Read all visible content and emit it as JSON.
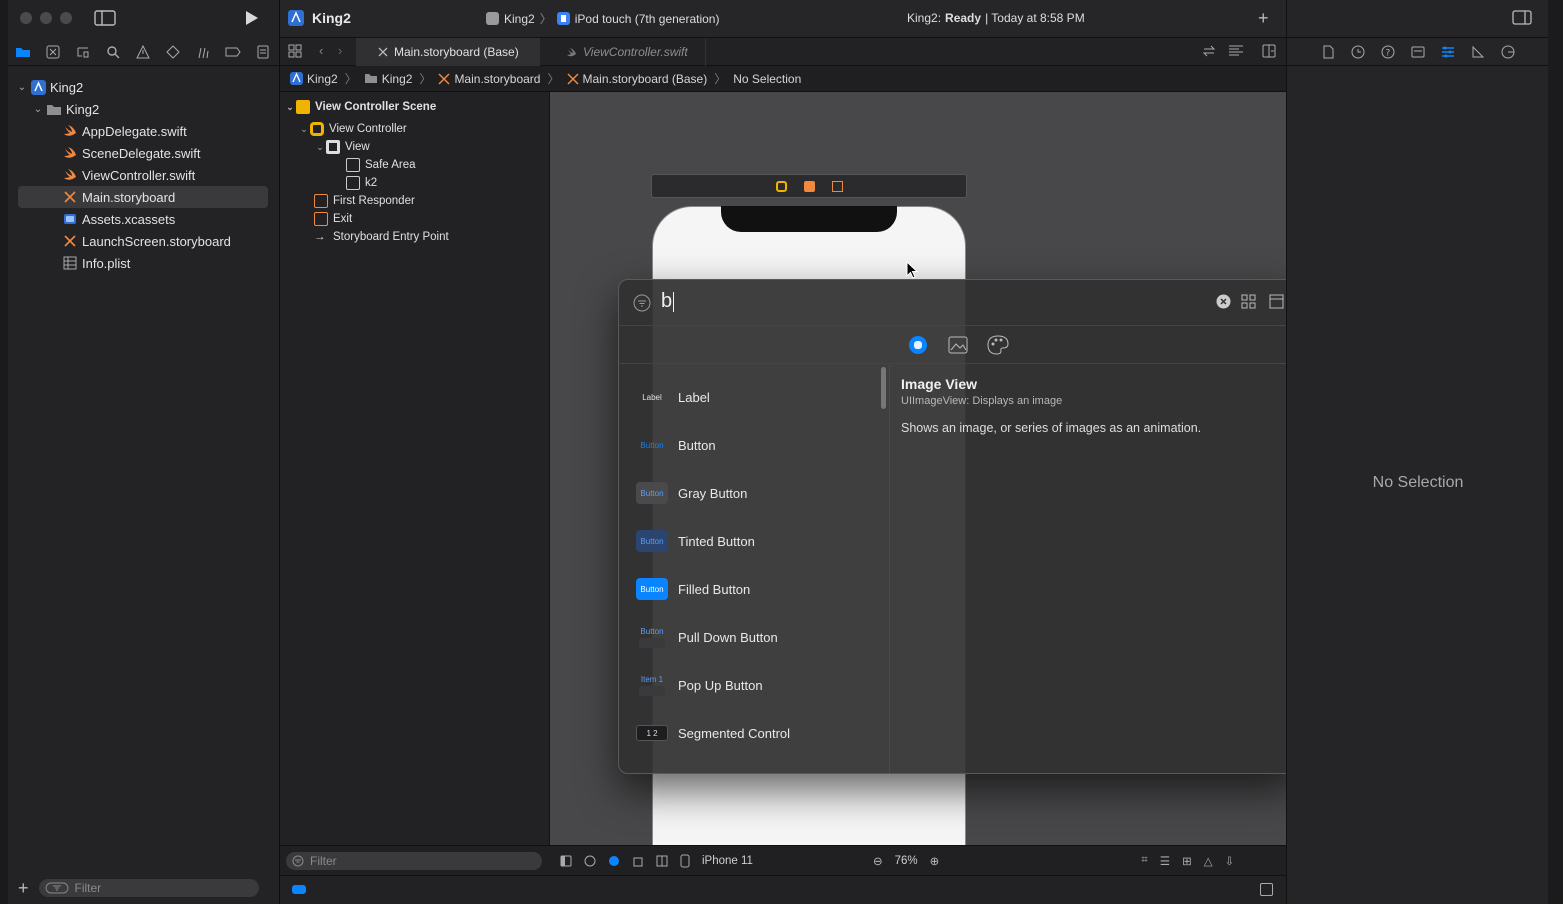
{
  "navigator": {
    "project_name": "King2",
    "items": [
      {
        "label": "King2",
        "icon": "project-icon",
        "level": 0,
        "expanded": true
      },
      {
        "label": "King2",
        "icon": "folder-icon",
        "level": 1,
        "expanded": true
      },
      {
        "label": "AppDelegate.swift",
        "icon": "swift-file-icon",
        "level": 2
      },
      {
        "label": "SceneDelegate.swift",
        "icon": "swift-file-icon",
        "level": 2
      },
      {
        "label": "ViewController.swift",
        "icon": "swift-file-icon",
        "level": 2
      },
      {
        "label": "Main.storyboard",
        "icon": "storyboard-icon",
        "level": 2,
        "selected": true
      },
      {
        "label": "Assets.xcassets",
        "icon": "assets-icon",
        "level": 2
      },
      {
        "label": "LaunchScreen.storyboard",
        "icon": "storyboard-icon",
        "level": 2
      },
      {
        "label": "Info.plist",
        "icon": "plist-icon",
        "level": 2
      }
    ],
    "filter_placeholder": "Filter"
  },
  "toolbar": {
    "project_title": "King2",
    "scheme": "King2",
    "destination": "iPod touch (7th generation)",
    "status_project": "King2:",
    "status_state": "Ready",
    "status_time": "| Today at 8:58 PM"
  },
  "tabs": [
    {
      "label": "Main.storyboard (Base)",
      "active": true
    },
    {
      "label": "ViewController.swift",
      "active": false
    }
  ],
  "jumpbar": [
    "King2",
    "King2",
    "Main.storyboard",
    "Main.storyboard (Base)",
    "No Selection"
  ],
  "outline": {
    "items": [
      {
        "label": "View Controller Scene",
        "bold": true
      },
      {
        "label": "View Controller"
      },
      {
        "label": "View"
      },
      {
        "label": "Safe Area"
      },
      {
        "label": "k2"
      },
      {
        "label": "First Responder"
      },
      {
        "label": "Exit"
      },
      {
        "label": "Storyboard Entry Point"
      }
    ],
    "filter_placeholder": "Filter"
  },
  "canvas_bar": {
    "device": "iPhone 11",
    "zoom": "76%"
  },
  "inspector": {
    "empty_text": "No Selection"
  },
  "library": {
    "search_value": "b",
    "items": [
      {
        "name": "Label",
        "thumb": "Label"
      },
      {
        "name": "Button",
        "thumb": "Button"
      },
      {
        "name": "Gray Button",
        "thumb": "Button"
      },
      {
        "name": "Tinted Button",
        "thumb": "Button"
      },
      {
        "name": "Filled Button",
        "thumb": "Button"
      },
      {
        "name": "Pull Down Button",
        "thumb": "Button"
      },
      {
        "name": "Pop Up Button",
        "thumb": "Item 1"
      },
      {
        "name": "Segmented Control",
        "thumb": "1 2"
      }
    ],
    "detail": {
      "title": "Image View",
      "subtitle": "UIImageView: Displays an image",
      "description": "Shows an image, or series of images as an animation."
    }
  },
  "colors": {
    "accent": "#0a84ff",
    "panel": "#232325",
    "canvas": "#48484a",
    "swift": "#f0883e"
  }
}
